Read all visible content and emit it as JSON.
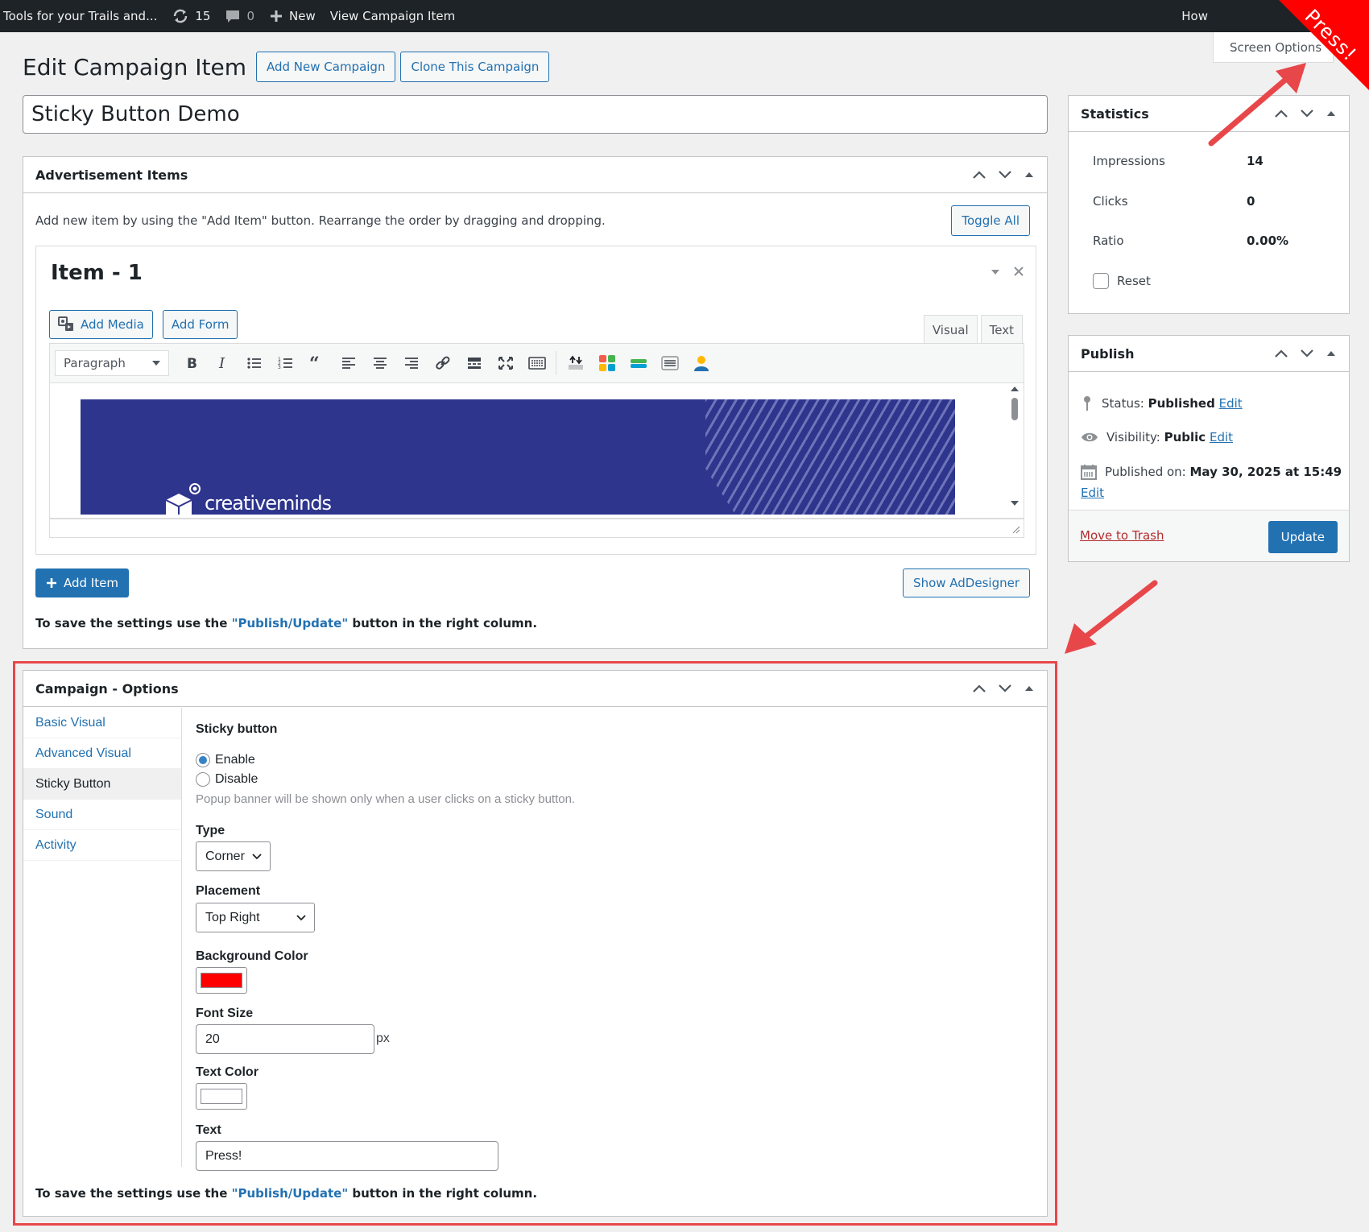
{
  "colors": {
    "accent": "#2271b1",
    "adminbar": "#1d2327",
    "highlight_red": "#ff0000",
    "outline_red": "#e8474a",
    "background_color_value": "#ff0000",
    "text_color_value": "#ffffff"
  },
  "adminbar": {
    "site_name": "Tools for your Trails and...",
    "updates_count": "15",
    "comments_count": "0",
    "new_label": "New",
    "view_label": "View Campaign Item",
    "howdy": "How"
  },
  "sticky_corner": {
    "text": "Press!"
  },
  "screen_options": "Screen Options",
  "heading": {
    "title": "Edit Campaign Item",
    "add_new": "Add New Campaign",
    "clone": "Clone This Campaign"
  },
  "post_title": "Sticky Button Demo",
  "ad_items": {
    "title": "Advertisement Items",
    "help": "Add new item by using the \"Add Item\" button. Rearrange the order by dragging and dropping.",
    "toggle_all": "Toggle All",
    "item": {
      "title": "Item - 1",
      "add_media": "Add Media",
      "add_form": "Add Form",
      "tab_visual": "Visual",
      "tab_text": "Text",
      "format": "Paragraph",
      "banner_logo": "creativeminds"
    },
    "add_item": "Add Item",
    "show_adesigner": "Show AdDesigner",
    "save_note_pre": "To save the settings use the ",
    "save_note_hl": "\"Publish/Update\"",
    "save_note_post": " button in the right column."
  },
  "campaign_options": {
    "title": "Campaign - Options",
    "tabs": [
      {
        "label": "Basic Visual"
      },
      {
        "label": "Advanced Visual"
      },
      {
        "label": "Sticky Button"
      },
      {
        "label": "Sound"
      },
      {
        "label": "Activity"
      }
    ],
    "sticky_heading": "Sticky button",
    "enable": "Enable",
    "disable": "Disable",
    "description": "Popup banner will be shown only when a user clicks on a sticky button.",
    "type_label": "Type",
    "type_value": "Corner",
    "placement_label": "Placement",
    "placement_value": "Top Right",
    "bg_color_label": "Background Color",
    "font_size_label": "Font Size",
    "font_size_value": "20",
    "font_size_unit": "px",
    "text_color_label": "Text Color",
    "text_label": "Text",
    "text_value": "Press!",
    "save_note_pre": "To save the settings use the ",
    "save_note_hl": "\"Publish/Update\"",
    "save_note_post": " button in the right column."
  },
  "statistics": {
    "title": "Statistics",
    "impressions_label": "Impressions",
    "impressions_value": "14",
    "clicks_label": "Clicks",
    "clicks_value": "0",
    "ratio_label": "Ratio",
    "ratio_value": "0.00%",
    "reset_label": "Reset"
  },
  "publish": {
    "title": "Publish",
    "status_label": "Status: ",
    "status_value": "Published",
    "visibility_label": "Visibility: ",
    "visibility_value": "Public",
    "published_label": "Published on: ",
    "published_value": "May 30, 2025 at 15:49",
    "edit": "Edit",
    "move_to_trash": "Move to Trash",
    "update": "Update"
  }
}
